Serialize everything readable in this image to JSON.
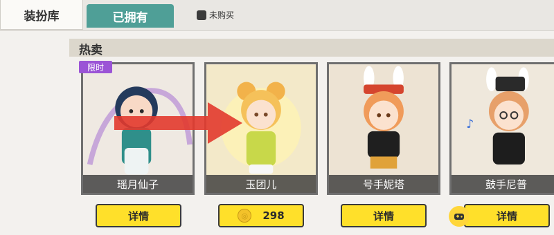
{
  "tabs": {
    "wardrobe": "装扮库",
    "owned": "已拥有"
  },
  "filter": {
    "label": "未购买"
  },
  "section": {
    "title": "热卖"
  },
  "cards": [
    {
      "name": "瑶月仙子",
      "badge": "限时",
      "action": "详情"
    },
    {
      "name": "玉团儿",
      "action": "298"
    },
    {
      "name": "号手妮塔",
      "action": "详情"
    },
    {
      "name": "鼓手尼普",
      "action": "详情"
    }
  ],
  "colors": {
    "accent_teal": "#4f9f97",
    "button_yellow": "#ffe02a",
    "badge_purple": "#9b54d6",
    "arrow_red": "#e23a2e"
  }
}
